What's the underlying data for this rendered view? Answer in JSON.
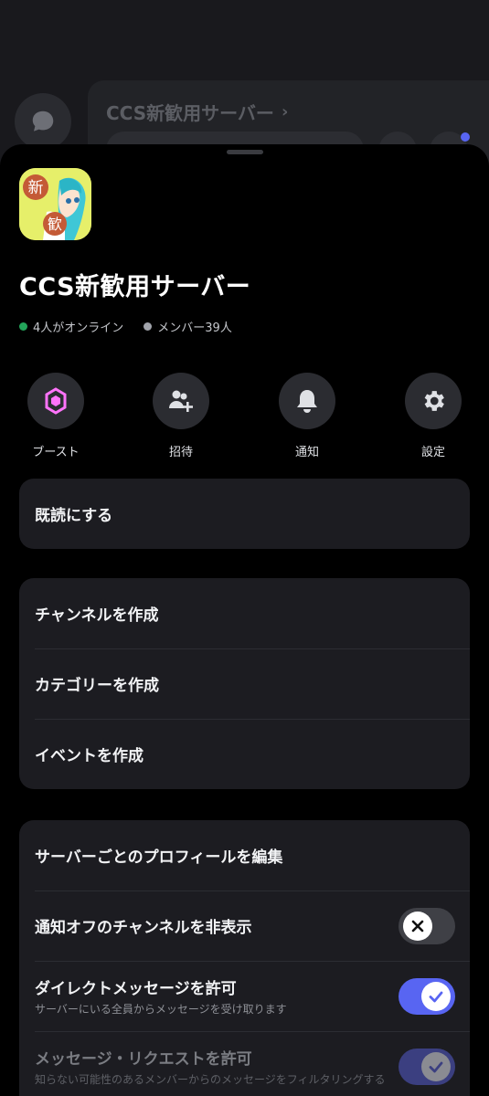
{
  "background": {
    "title": "CCS新歓用サーバー"
  },
  "server": {
    "name": "CCS新歓用サーバー",
    "icon_text": [
      "新",
      "歓"
    ],
    "online_text": "4人がオンライン",
    "members_text": "メンバー39人",
    "online_color": "#23a55a",
    "members_color": "#a1a4ab"
  },
  "actions": [
    {
      "label": "ブースト",
      "icon": "boost-icon"
    },
    {
      "label": "招待",
      "icon": "invite-icon"
    },
    {
      "label": "通知",
      "icon": "bell-icon"
    },
    {
      "label": "設定",
      "icon": "gear-icon"
    }
  ],
  "group1": {
    "mark_read": "既読にする"
  },
  "group2": {
    "create_channel": "チャンネルを作成",
    "create_category": "カテゴリーを作成",
    "create_event": "イベントを作成"
  },
  "group3": {
    "edit_profile": "サーバーごとのプロフィールを編集",
    "hide_muted": {
      "label": "通知オフのチャンネルを非表示",
      "state": "off"
    },
    "allow_dm": {
      "label": "ダイレクトメッセージを許可",
      "sub": "サーバーにいる全員からメッセージを受け取ります",
      "state": "on"
    },
    "allow_requests": {
      "label": "メッセージ・リクエストを許可",
      "sub": "知らない可能性のあるメンバーからのメッセージをフィルタリングする",
      "state": "on"
    }
  },
  "colors": {
    "accent": "#5865f2",
    "boost": "#ff73fa"
  }
}
